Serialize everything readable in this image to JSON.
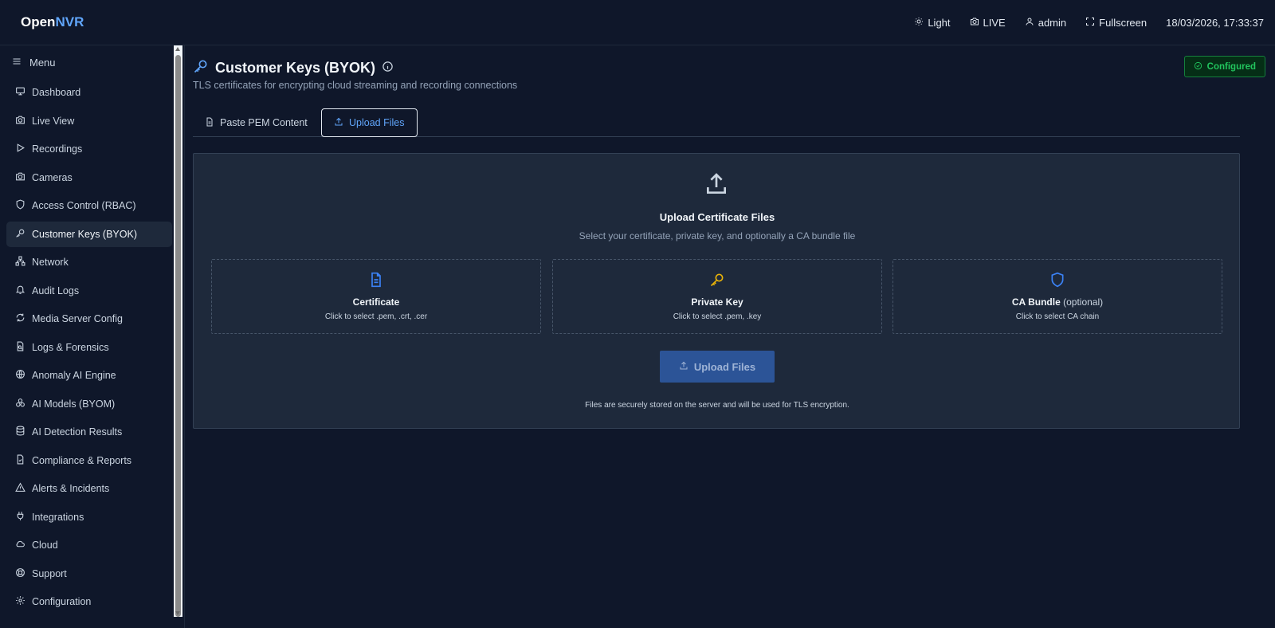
{
  "app": {
    "brand_prefix": "Open",
    "brand_suffix": "NVR"
  },
  "topbar": {
    "theme_label": "Light",
    "live_label": "LIVE",
    "user_label": "admin",
    "fullscreen_label": "Fullscreen",
    "datetime": "18/03/2026, 17:33:37"
  },
  "sidebar": {
    "menu_label": "Menu",
    "items": [
      {
        "label": "Dashboard",
        "icon": "monitor-icon"
      },
      {
        "label": "Live View",
        "icon": "camera-icon"
      },
      {
        "label": "Recordings",
        "icon": "play-icon"
      },
      {
        "label": "Cameras",
        "icon": "camera-icon"
      },
      {
        "label": "Access Control (RBAC)",
        "icon": "shield-icon"
      },
      {
        "label": "Customer Keys (BYOK)",
        "icon": "key-icon",
        "active": true
      },
      {
        "label": "Network",
        "icon": "network-icon"
      },
      {
        "label": "Audit Logs",
        "icon": "bell-icon"
      },
      {
        "label": "Media Server Config",
        "icon": "refresh-icon"
      },
      {
        "label": "Logs & Forensics",
        "icon": "file-search-icon"
      },
      {
        "label": "Anomaly AI Engine",
        "icon": "globe-icon"
      },
      {
        "label": "AI Models (BYOM)",
        "icon": "boxes-icon"
      },
      {
        "label": "AI Detection Results",
        "icon": "database-icon"
      },
      {
        "label": "Compliance & Reports",
        "icon": "file-check-icon"
      },
      {
        "label": "Alerts & Incidents",
        "icon": "alert-triangle-icon"
      },
      {
        "label": "Integrations",
        "icon": "plug-icon"
      },
      {
        "label": "Cloud",
        "icon": "cloud-icon"
      },
      {
        "label": "Support",
        "icon": "lifebuoy-icon"
      },
      {
        "label": "Configuration",
        "icon": "gear-icon"
      }
    ]
  },
  "page": {
    "title": "Customer Keys (BYOK)",
    "subtitle": "TLS certificates for encrypting cloud streaming and recording connections",
    "status_badge": "Configured",
    "tabs": [
      {
        "label": "Paste PEM Content"
      },
      {
        "label": "Upload Files",
        "active": true
      }
    ]
  },
  "upload": {
    "title": "Upload Certificate Files",
    "subtitle": "Select your certificate, private key, and optionally a CA bundle file",
    "cards": [
      {
        "label": "Certificate",
        "optional": "",
        "hint": "Click to select .pem, .crt, .cer",
        "icon": "file-text-icon",
        "color": "#3b82f6"
      },
      {
        "label": "Private Key",
        "optional": "",
        "hint": "Click to select .pem, .key",
        "icon": "key-icon",
        "color": "#eab308"
      },
      {
        "label": "CA Bundle",
        "optional": "(optional)",
        "hint": "Click to select CA chain",
        "icon": "shield-icon",
        "color": "#3b82f6"
      }
    ],
    "button_label": "Upload Files",
    "footnote": "Files are securely stored on the server and will be used for TLS encryption."
  }
}
